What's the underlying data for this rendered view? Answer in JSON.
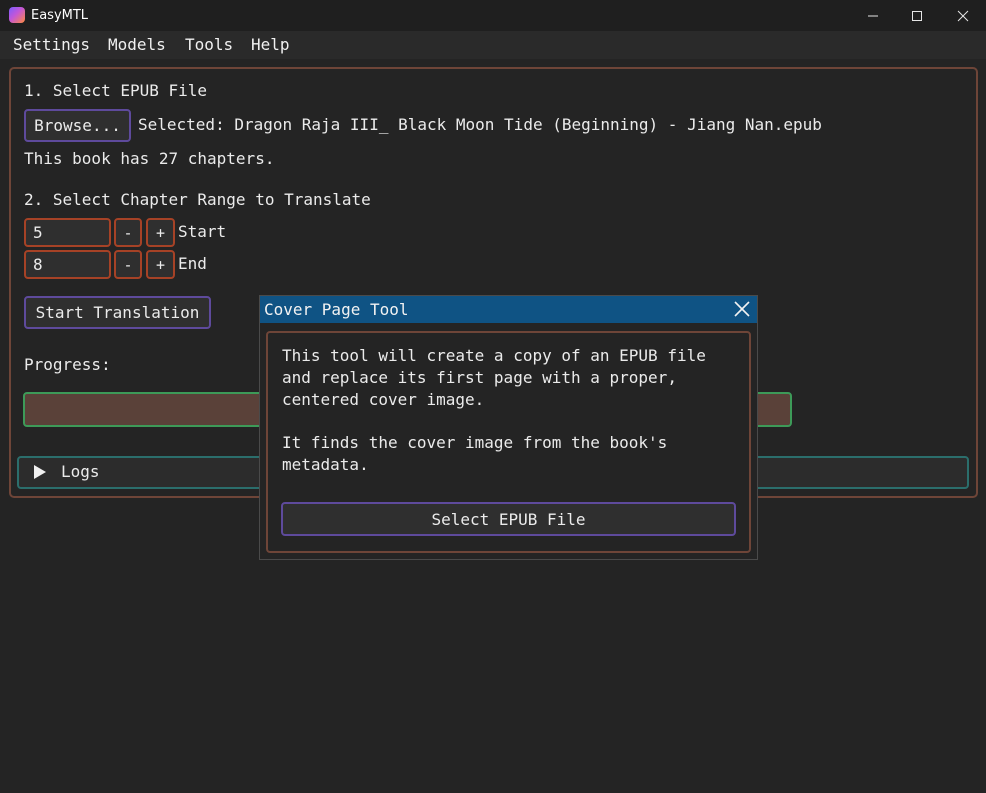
{
  "window": {
    "title": "EasyMTL"
  },
  "menu": {
    "items": [
      "Settings",
      "Models",
      "Tools",
      "Help"
    ]
  },
  "section1": {
    "heading": "1. Select EPUB File",
    "browse_label": "Browse...",
    "selected_text": "Selected: Dragon Raja III_ Black Moon Tide (Beginning) - Jiang Nan.epub",
    "chapters_info": "This book has 27 chapters."
  },
  "section2": {
    "heading": "2. Select Chapter Range to Translate",
    "start": {
      "value": "5",
      "minus": "-",
      "plus": "+",
      "label": "Start"
    },
    "end": {
      "value": "8",
      "minus": "-",
      "plus": "+",
      "label": "End"
    }
  },
  "actions": {
    "start_translation": "Start Translation"
  },
  "progress": {
    "label": "Progress:",
    "value": 0
  },
  "logs": {
    "label": "Logs",
    "expanded": false
  },
  "dialog": {
    "title": "Cover Page Tool",
    "desc_lines": [
      "This tool will create a copy of an EPUB file",
      "and replace its first page with a proper,",
      "centered cover image.",
      "",
      "It finds the cover image from the book's",
      "metadata."
    ],
    "button": "Select EPUB File"
  },
  "icons": {
    "app": "app-icon",
    "minimize": "minimize-icon",
    "maximize": "maximize-icon",
    "close": "close-icon",
    "expand": "triangle-right-icon"
  },
  "colors": {
    "accent_border": "#6e4538",
    "field_border": "#a64226",
    "button_border": "#5e4a9c",
    "progress_border": "#3d9a58",
    "logs_border": "#2b6e6c",
    "dialog_title_bg": "#0f5384"
  }
}
